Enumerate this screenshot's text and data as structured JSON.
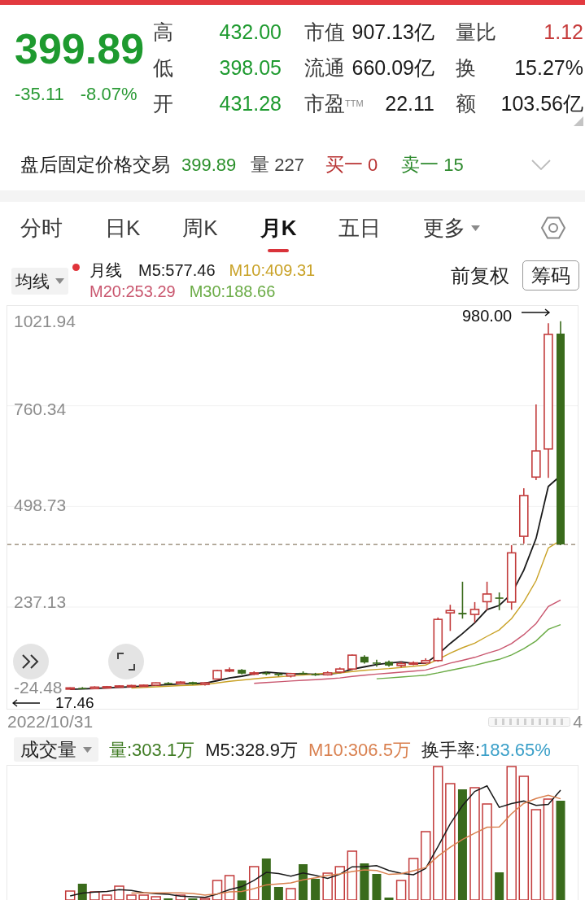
{
  "quote": {
    "price": "399.89",
    "change": "-35.11",
    "change_percent": "-8.07%"
  },
  "stat_columns": [
    {
      "items": [
        {
          "label": "高",
          "value": "432.00",
          "color": "#1e9a2f"
        },
        {
          "label": "低",
          "value": "398.05",
          "color": "#1e9a2f"
        },
        {
          "label": "开",
          "value": "431.28",
          "color": "#1e9a2f"
        }
      ]
    },
    {
      "items": [
        {
          "label": "市值",
          "value": "907.13亿",
          "color": "#1a1a1a"
        },
        {
          "label": "流通",
          "value": "660.09亿",
          "color": "#1a1a1a"
        },
        {
          "label": "市盈$^{TTM}$",
          "value": "22.11",
          "color": "#1a1a1a"
        }
      ]
    },
    {
      "items": [
        {
          "label": "量比",
          "value": "1.12",
          "color": "#c63b3b"
        },
        {
          "label": "换",
          "value": "15.27%",
          "color": "#1a1a1a"
        },
        {
          "label": "额",
          "value": "103.56亿",
          "color": "#1a1a1a"
        }
      ]
    }
  ],
  "after_hours": {
    "label": "盘后固定价格交易",
    "price": "399.89",
    "volume_label": "量",
    "volume": "227",
    "bid_label": "买一",
    "bid": "0",
    "ask_label": "卖一",
    "ask": "15"
  },
  "tabs": [
    {
      "label": "分时",
      "selected": false,
      "kind": "plain"
    },
    {
      "label": "日K",
      "selected": false,
      "kind": "plain"
    },
    {
      "label": "周K",
      "selected": false,
      "kind": "plain"
    },
    {
      "label": "月K",
      "selected": true,
      "kind": "plain"
    },
    {
      "label": "五日",
      "selected": false,
      "kind": "plain"
    },
    {
      "label": "更多",
      "selected": false,
      "kind": "menu"
    }
  ],
  "indicator_bar": {
    "selector": "均线",
    "period": "月线",
    "lines": [
      {
        "label": "M5:577.46",
        "color": "#1a1a1a"
      },
      {
        "label": "M10:409.31",
        "color": "#c9a227"
      },
      {
        "label": "M20:253.29",
        "color": "#c9566e"
      },
      {
        "label": "M30:188.66",
        "color": "#6aab45"
      }
    ],
    "adjustment": "前复权",
    "chips_button": "筹码"
  },
  "price_chart": {
    "y_axis_labels": [
      "1021.94",
      "760.34",
      "498.73",
      "237.13",
      "-24.48"
    ],
    "high_label": "980.00",
    "low_label": "17.46"
  },
  "x_axis": {
    "start_label": "2022/10/31",
    "end_label": "4"
  },
  "volume": {
    "selector": "成交量",
    "readings": [
      {
        "label": "量:303.1万",
        "color": "#3e7b22"
      },
      {
        "label": "M5:328.9万",
        "color": "#1a1a1a"
      },
      {
        "label": "M10:306.5万",
        "color": "#d9804f"
      }
    ],
    "turnover_label": "换手率:",
    "turnover_value": "183.65%"
  }
}
